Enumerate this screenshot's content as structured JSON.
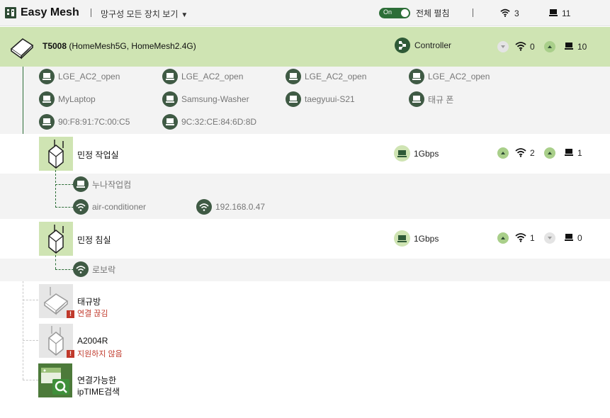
{
  "header": {
    "title": "Easy Mesh",
    "view_label": "망구성 모든 장치 보기",
    "toggle_label": "On",
    "expand_label": "전체 펼침",
    "wifi_count": "3",
    "wired_count": "11"
  },
  "controller": {
    "model": "T5008",
    "ssids": "(HomeMesh5G, HomeMesh2.4G)",
    "role": "Controller",
    "wifi_count": "0",
    "wired_count": "10",
    "clients": [
      {
        "name": "LGE_AC2_open",
        "type": "wired"
      },
      {
        "name": "LGE_AC2_open",
        "type": "wired"
      },
      {
        "name": "LGE_AC2_open",
        "type": "wired"
      },
      {
        "name": "LGE_AC2_open",
        "type": "wired"
      },
      {
        "name": "MyLaptop",
        "type": "wired"
      },
      {
        "name": "Samsung-Washer",
        "type": "wired"
      },
      {
        "name": "taegyuui-S21",
        "type": "wired"
      },
      {
        "name": "태규 폰",
        "type": "wired"
      },
      {
        "name": "90:F8:91:7C:00:C5",
        "type": "wired"
      },
      {
        "name": "9C:32:CE:84:6D:8D",
        "type": "wired"
      }
    ]
  },
  "extenders": [
    {
      "name": "민정 작업실",
      "link": "1Gbps",
      "wifi_count": "2",
      "wired_count": "1",
      "clients": [
        {
          "name": "누나작업컴",
          "type": "wired"
        },
        {
          "name": "air-conditioner",
          "type": "wifi"
        },
        {
          "name": "192.168.0.47",
          "type": "wifi"
        }
      ]
    },
    {
      "name": "민정 침실",
      "link": "1Gbps",
      "wifi_count": "1",
      "wired_count": "0",
      "clients": [
        {
          "name": "로보락",
          "type": "wifi"
        }
      ]
    }
  ],
  "offline": [
    {
      "name": "태규방",
      "status": "연결 끊김"
    },
    {
      "name": "A2004R",
      "status": "지원하지 않음"
    }
  ],
  "find": {
    "line1": "연결가능한",
    "line2": "ipTIME검색"
  },
  "colors": {
    "accent": "#2d6e38",
    "highlight": "#cfe4b3",
    "warning": "#c0392b"
  }
}
